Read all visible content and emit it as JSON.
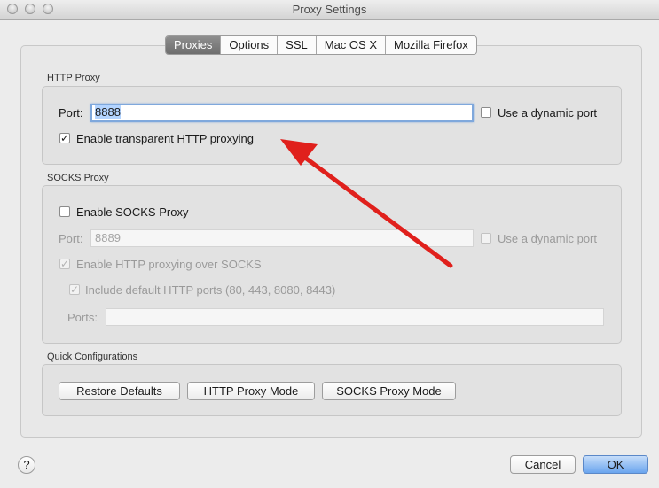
{
  "window": {
    "title": "Proxy Settings"
  },
  "tabs": [
    {
      "label": "Proxies",
      "active": true
    },
    {
      "label": "Options",
      "active": false
    },
    {
      "label": "SSL",
      "active": false
    },
    {
      "label": "Mac OS X",
      "active": false
    },
    {
      "label": "Mozilla Firefox",
      "active": false
    }
  ],
  "http_proxy": {
    "section_label": "HTTP Proxy",
    "port_label": "Port:",
    "port_value": "8888",
    "dynamic_port_label": "Use a dynamic port",
    "dynamic_port_checked": false,
    "transparent_label": "Enable transparent HTTP proxying",
    "transparent_checked": true
  },
  "socks_proxy": {
    "section_label": "SOCKS Proxy",
    "enable_label": "Enable SOCKS Proxy",
    "enable_checked": false,
    "port_label": "Port:",
    "port_value": "8889",
    "dynamic_port_label": "Use a dynamic port",
    "http_over_socks_label": "Enable HTTP proxying over SOCKS",
    "http_over_socks_checked": true,
    "include_ports_label": "Include default HTTP ports (80, 443, 8080, 8443)",
    "include_ports_checked": true,
    "ports_label": "Ports:",
    "ports_value": ""
  },
  "quick": {
    "section_label": "Quick Configurations",
    "restore_label": "Restore Defaults",
    "http_mode_label": "HTTP Proxy Mode",
    "socks_mode_label": "SOCKS Proxy Mode"
  },
  "footer": {
    "help_label": "?",
    "cancel_label": "Cancel",
    "ok_label": "OK"
  },
  "colors": {
    "annotation_arrow": "#e0201c",
    "focus_ring": "#7fa8dc"
  },
  "icons": {
    "check": "✓"
  }
}
